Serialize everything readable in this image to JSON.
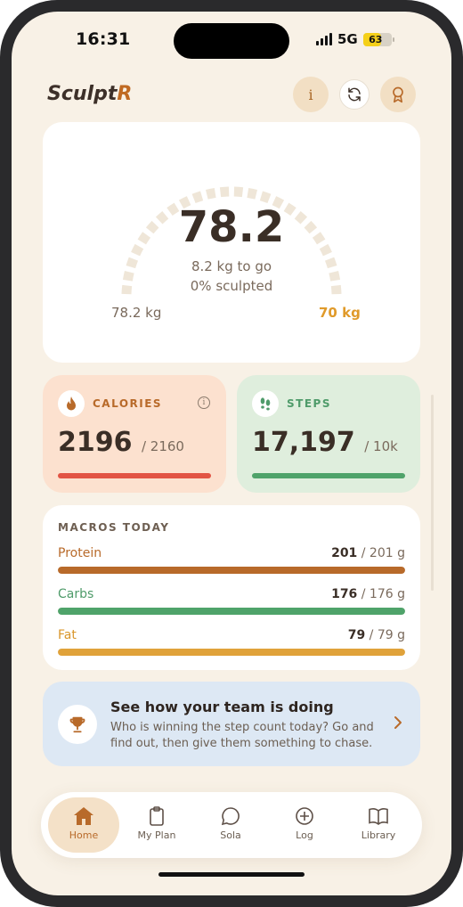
{
  "status_bar": {
    "time": "16:31",
    "network": "5G",
    "battery": "63"
  },
  "header": {
    "logo_main": "Sculpt",
    "logo_accent": "R",
    "info_label": "i"
  },
  "gauge": {
    "value": "78.2",
    "to_go": "8.2 kg to go",
    "progress_text": "0% sculpted",
    "start_label": "78.2  kg",
    "target_label": "70 kg",
    "progress": 0
  },
  "calories": {
    "label": "CALORIES",
    "value": "2196",
    "goal": "/ 2160",
    "info": "i"
  },
  "steps": {
    "label": "STEPS",
    "value": "17,197",
    "goal": "/ 10k"
  },
  "macros": {
    "title": "MACROS TODAY",
    "items": [
      {
        "name": "Protein",
        "value": "201",
        "goal": "/ 201 g",
        "color": "#b86a2a",
        "progress": 1.0
      },
      {
        "name": "Carbs",
        "value": "176",
        "goal": "/ 176 g",
        "color": "#4fa36a",
        "progress": 1.0
      },
      {
        "name": "Fat",
        "value": "79",
        "goal": "/ 79 g",
        "color": "#e0a23a",
        "progress": 1.0
      }
    ]
  },
  "team": {
    "title": "See how your team is doing",
    "description": "Who is winning the step count today? Go and find out, then give them something to chase."
  },
  "tabs": [
    {
      "label": "Home",
      "icon": "home-icon",
      "active": true
    },
    {
      "label": "My Plan",
      "icon": "clipboard-icon",
      "active": false
    },
    {
      "label": "Sola",
      "icon": "chat-icon",
      "active": false
    },
    {
      "label": "Log",
      "icon": "plus-circle-icon",
      "active": false
    },
    {
      "label": "Library",
      "icon": "book-icon",
      "active": false
    }
  ],
  "colors": {
    "accent": "#b86a2a",
    "background": "#f8f1e6",
    "calories_bg": "#fce1cf",
    "steps_bg": "#dfeedd",
    "team_bg": "#dde8f4"
  }
}
